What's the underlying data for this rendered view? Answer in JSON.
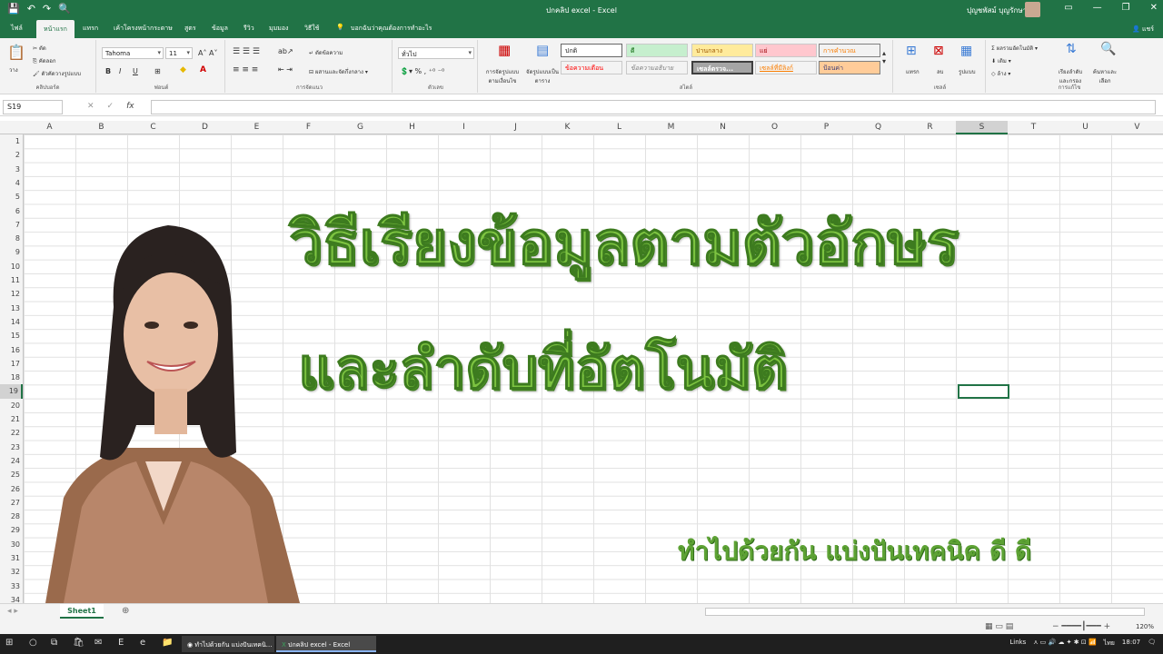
{
  "window": {
    "title": "ปกคลิป excel  -  Excel",
    "user": "ปุญชพัสม์ บุญรักษา",
    "quick_access": [
      "💾",
      "↶",
      "↷",
      "🔍"
    ]
  },
  "ribbon_tabs": [
    "ไฟล์",
    "หน้าแรก",
    "แทรก",
    "เค้าโครงหน้ากระดาษ",
    "สูตร",
    "ข้อมูล",
    "รีวิว",
    "มุมมอง",
    "วิธีใช้"
  ],
  "tell_me": "บอกฉันว่าคุณต้องการทำอะไร",
  "share_label": "แชร์",
  "ribbon": {
    "clipboard": {
      "paste": "วาง",
      "cut": "ตัด",
      "copy": "คัดลอก",
      "format_painter": "ตัวคัดวางรูปแบบ",
      "label": "คลิปบอร์ด"
    },
    "font": {
      "name": "Tahoma",
      "size": "11",
      "bold": "B",
      "italic": "I",
      "underline": "U",
      "label": "ฟอนต์"
    },
    "alignment": {
      "wrap": "ตัดข้อความ",
      "merge": "ผสานและจัดกึ่งกลาง",
      "label": "การจัดแนว"
    },
    "number": {
      "format": "ทั่วไป",
      "label": "ตัวเลข"
    },
    "styles": {
      "conditional": "การจัดรูปแบบตามเงื่อนไข",
      "as_table": "จัดรูปแบบเป็นตาราง",
      "cells": [
        "ปกติ",
        "ดี",
        "ปานกลาง",
        "แย่",
        "การคำนวณ",
        "ข้อความเตือน",
        "ข้อความอธิบาย",
        "เซลล์ตรวจ...",
        "เซลล์ที่มีลิงก์",
        "ป้อนค่า"
      ],
      "label": "สไตล์"
    },
    "cells": {
      "insert": "แทรก",
      "delete": "ลบ",
      "format": "รูปแบบ",
      "label": "เซลล์"
    },
    "editing": {
      "autosum": "ผลรวมอัตโนมัติ",
      "fill": "เติม",
      "clear": "ล้าง",
      "sort": "เรียงลำดับและกรอง",
      "find": "ค้นหาและเลือก",
      "label": "การแก้ไข"
    }
  },
  "formula_bar": {
    "name_box": "S19",
    "fx": "fx",
    "content": ""
  },
  "columns": [
    "A",
    "B",
    "C",
    "D",
    "E",
    "F",
    "G",
    "H",
    "I",
    "J",
    "K",
    "L",
    "M",
    "N",
    "O",
    "P",
    "Q",
    "R",
    "S",
    "T",
    "U",
    "V"
  ],
  "rows": [
    "1",
    "2",
    "3",
    "4",
    "5",
    "6",
    "7",
    "8",
    "9",
    "10",
    "11",
    "12",
    "13",
    "14",
    "15",
    "16",
    "17",
    "18",
    "19",
    "20",
    "21",
    "22",
    "23",
    "24",
    "25",
    "26",
    "27",
    "28",
    "29",
    "30",
    "31",
    "32",
    "33",
    "34"
  ],
  "content": {
    "headline_line1": "วิธีเรียงข้อมูลตามตัวอักษร",
    "headline_line2": "และลำดับที่อัตโนมัติ",
    "tagline": "ทำไปด้วยกัน แบ่งปันเทคนิค ดี ดี"
  },
  "sheet_tabs": [
    "Sheet1"
  ],
  "status": {
    "zoom": "120%"
  },
  "taskbar": {
    "apps": [
      "ทำไปด้วยกัน แบ่งปันเทคนิ...",
      "ปกคลิป excel - Excel"
    ],
    "links": "Links",
    "lang": "ไทย",
    "time": "18:07"
  },
  "colors": {
    "excel_green": "#217346",
    "headline_green": "#7dc441"
  }
}
